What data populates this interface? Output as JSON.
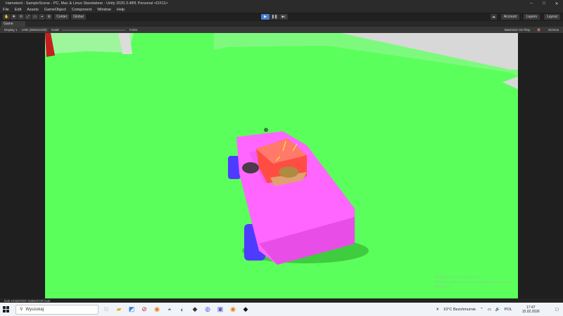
{
  "window": {
    "title": "Hamsterd - SampleScene - PC, Mac & Linux Standalone - Unity 2020.3.48f1 Personal <DX11>",
    "controls": [
      "–",
      "□",
      "✕"
    ]
  },
  "menu": [
    "File",
    "Edit",
    "Assets",
    "GameObject",
    "Component",
    "Window",
    "Help"
  ],
  "toolbar": {
    "tools": [
      "✋",
      "✥",
      "⟲",
      "⤢",
      "▭",
      "⌖",
      "⚙"
    ],
    "pivot": "Center",
    "space": "Global",
    "play": [
      "▶",
      "❚❚",
      "▶|"
    ],
    "account": "Account",
    "layers": "Layers",
    "layout": "Layout"
  },
  "game_tab": {
    "label": "Game",
    "display": "Display 1",
    "resolution": "UHD (3840x2160)",
    "scale": "Scale",
    "scale_value": "0.02x",
    "maximize": "Maximize On Play",
    "gizmos": "Gizmos"
  },
  "status": "look HAMSTER ANIMATOR look",
  "watermark": [
    "Aktywuj system Windows",
    "Przejdź do ustawień, aby aktywować system Windows."
  ],
  "taskbar": {
    "search_placeholder": "Wyszukaj",
    "weather": "10°C  Bezchmurnie",
    "language": "POL",
    "time": "17:47",
    "date": "15.02.2026"
  },
  "colors": {
    "ground": "#5bff5c",
    "car": "#ff66ff",
    "wheels": "#4d3bff",
    "box": "#ff4d44",
    "wall": "#d8d8d8",
    "pillar": "#c41f1f"
  }
}
